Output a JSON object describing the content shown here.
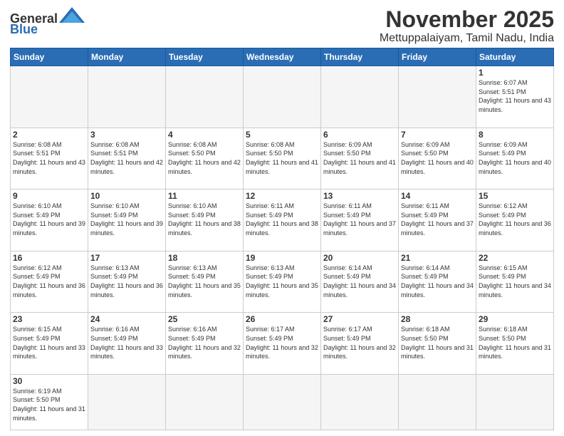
{
  "header": {
    "logo_general": "General",
    "logo_blue": "Blue",
    "month_title": "November 2025",
    "location": "Mettuppalaiyam, Tamil Nadu, India"
  },
  "days_of_week": [
    "Sunday",
    "Monday",
    "Tuesday",
    "Wednesday",
    "Thursday",
    "Friday",
    "Saturday"
  ],
  "weeks": [
    [
      {
        "day": "",
        "empty": true
      },
      {
        "day": "",
        "empty": true
      },
      {
        "day": "",
        "empty": true
      },
      {
        "day": "",
        "empty": true
      },
      {
        "day": "",
        "empty": true
      },
      {
        "day": "",
        "empty": true
      },
      {
        "day": "1",
        "sunrise": "6:07 AM",
        "sunset": "5:51 PM",
        "daylight": "11 hours and 43 minutes."
      }
    ],
    [
      {
        "day": "2",
        "sunrise": "6:08 AM",
        "sunset": "5:51 PM",
        "daylight": "11 hours and 43 minutes."
      },
      {
        "day": "3",
        "sunrise": "6:08 AM",
        "sunset": "5:51 PM",
        "daylight": "11 hours and 42 minutes."
      },
      {
        "day": "4",
        "sunrise": "6:08 AM",
        "sunset": "5:50 PM",
        "daylight": "11 hours and 42 minutes."
      },
      {
        "day": "5",
        "sunrise": "6:08 AM",
        "sunset": "5:50 PM",
        "daylight": "11 hours and 41 minutes."
      },
      {
        "day": "6",
        "sunrise": "6:09 AM",
        "sunset": "5:50 PM",
        "daylight": "11 hours and 41 minutes."
      },
      {
        "day": "7",
        "sunrise": "6:09 AM",
        "sunset": "5:50 PM",
        "daylight": "11 hours and 40 minutes."
      },
      {
        "day": "8",
        "sunrise": "6:09 AM",
        "sunset": "5:49 PM",
        "daylight": "11 hours and 40 minutes."
      }
    ],
    [
      {
        "day": "9",
        "sunrise": "6:10 AM",
        "sunset": "5:49 PM",
        "daylight": "11 hours and 39 minutes."
      },
      {
        "day": "10",
        "sunrise": "6:10 AM",
        "sunset": "5:49 PM",
        "daylight": "11 hours and 39 minutes."
      },
      {
        "day": "11",
        "sunrise": "6:10 AM",
        "sunset": "5:49 PM",
        "daylight": "11 hours and 38 minutes."
      },
      {
        "day": "12",
        "sunrise": "6:11 AM",
        "sunset": "5:49 PM",
        "daylight": "11 hours and 38 minutes."
      },
      {
        "day": "13",
        "sunrise": "6:11 AM",
        "sunset": "5:49 PM",
        "daylight": "11 hours and 37 minutes."
      },
      {
        "day": "14",
        "sunrise": "6:11 AM",
        "sunset": "5:49 PM",
        "daylight": "11 hours and 37 minutes."
      },
      {
        "day": "15",
        "sunrise": "6:12 AM",
        "sunset": "5:49 PM",
        "daylight": "11 hours and 36 minutes."
      }
    ],
    [
      {
        "day": "16",
        "sunrise": "6:12 AM",
        "sunset": "5:49 PM",
        "daylight": "11 hours and 36 minutes."
      },
      {
        "day": "17",
        "sunrise": "6:13 AM",
        "sunset": "5:49 PM",
        "daylight": "11 hours and 36 minutes."
      },
      {
        "day": "18",
        "sunrise": "6:13 AM",
        "sunset": "5:49 PM",
        "daylight": "11 hours and 35 minutes."
      },
      {
        "day": "19",
        "sunrise": "6:13 AM",
        "sunset": "5:49 PM",
        "daylight": "11 hours and 35 minutes."
      },
      {
        "day": "20",
        "sunrise": "6:14 AM",
        "sunset": "5:49 PM",
        "daylight": "11 hours and 34 minutes."
      },
      {
        "day": "21",
        "sunrise": "6:14 AM",
        "sunset": "5:49 PM",
        "daylight": "11 hours and 34 minutes."
      },
      {
        "day": "22",
        "sunrise": "6:15 AM",
        "sunset": "5:49 PM",
        "daylight": "11 hours and 34 minutes."
      }
    ],
    [
      {
        "day": "23",
        "sunrise": "6:15 AM",
        "sunset": "5:49 PM",
        "daylight": "11 hours and 33 minutes."
      },
      {
        "day": "24",
        "sunrise": "6:16 AM",
        "sunset": "5:49 PM",
        "daylight": "11 hours and 33 minutes."
      },
      {
        "day": "25",
        "sunrise": "6:16 AM",
        "sunset": "5:49 PM",
        "daylight": "11 hours and 32 minutes."
      },
      {
        "day": "26",
        "sunrise": "6:17 AM",
        "sunset": "5:49 PM",
        "daylight": "11 hours and 32 minutes."
      },
      {
        "day": "27",
        "sunrise": "6:17 AM",
        "sunset": "5:49 PM",
        "daylight": "11 hours and 32 minutes."
      },
      {
        "day": "28",
        "sunrise": "6:18 AM",
        "sunset": "5:50 PM",
        "daylight": "11 hours and 31 minutes."
      },
      {
        "day": "29",
        "sunrise": "6:18 AM",
        "sunset": "5:50 PM",
        "daylight": "11 hours and 31 minutes."
      }
    ],
    [
      {
        "day": "30",
        "sunrise": "6:19 AM",
        "sunset": "5:50 PM",
        "daylight": "11 hours and 31 minutes."
      },
      {
        "day": "",
        "empty": true
      },
      {
        "day": "",
        "empty": true
      },
      {
        "day": "",
        "empty": true
      },
      {
        "day": "",
        "empty": true
      },
      {
        "day": "",
        "empty": true
      },
      {
        "day": "",
        "empty": true
      }
    ]
  ]
}
